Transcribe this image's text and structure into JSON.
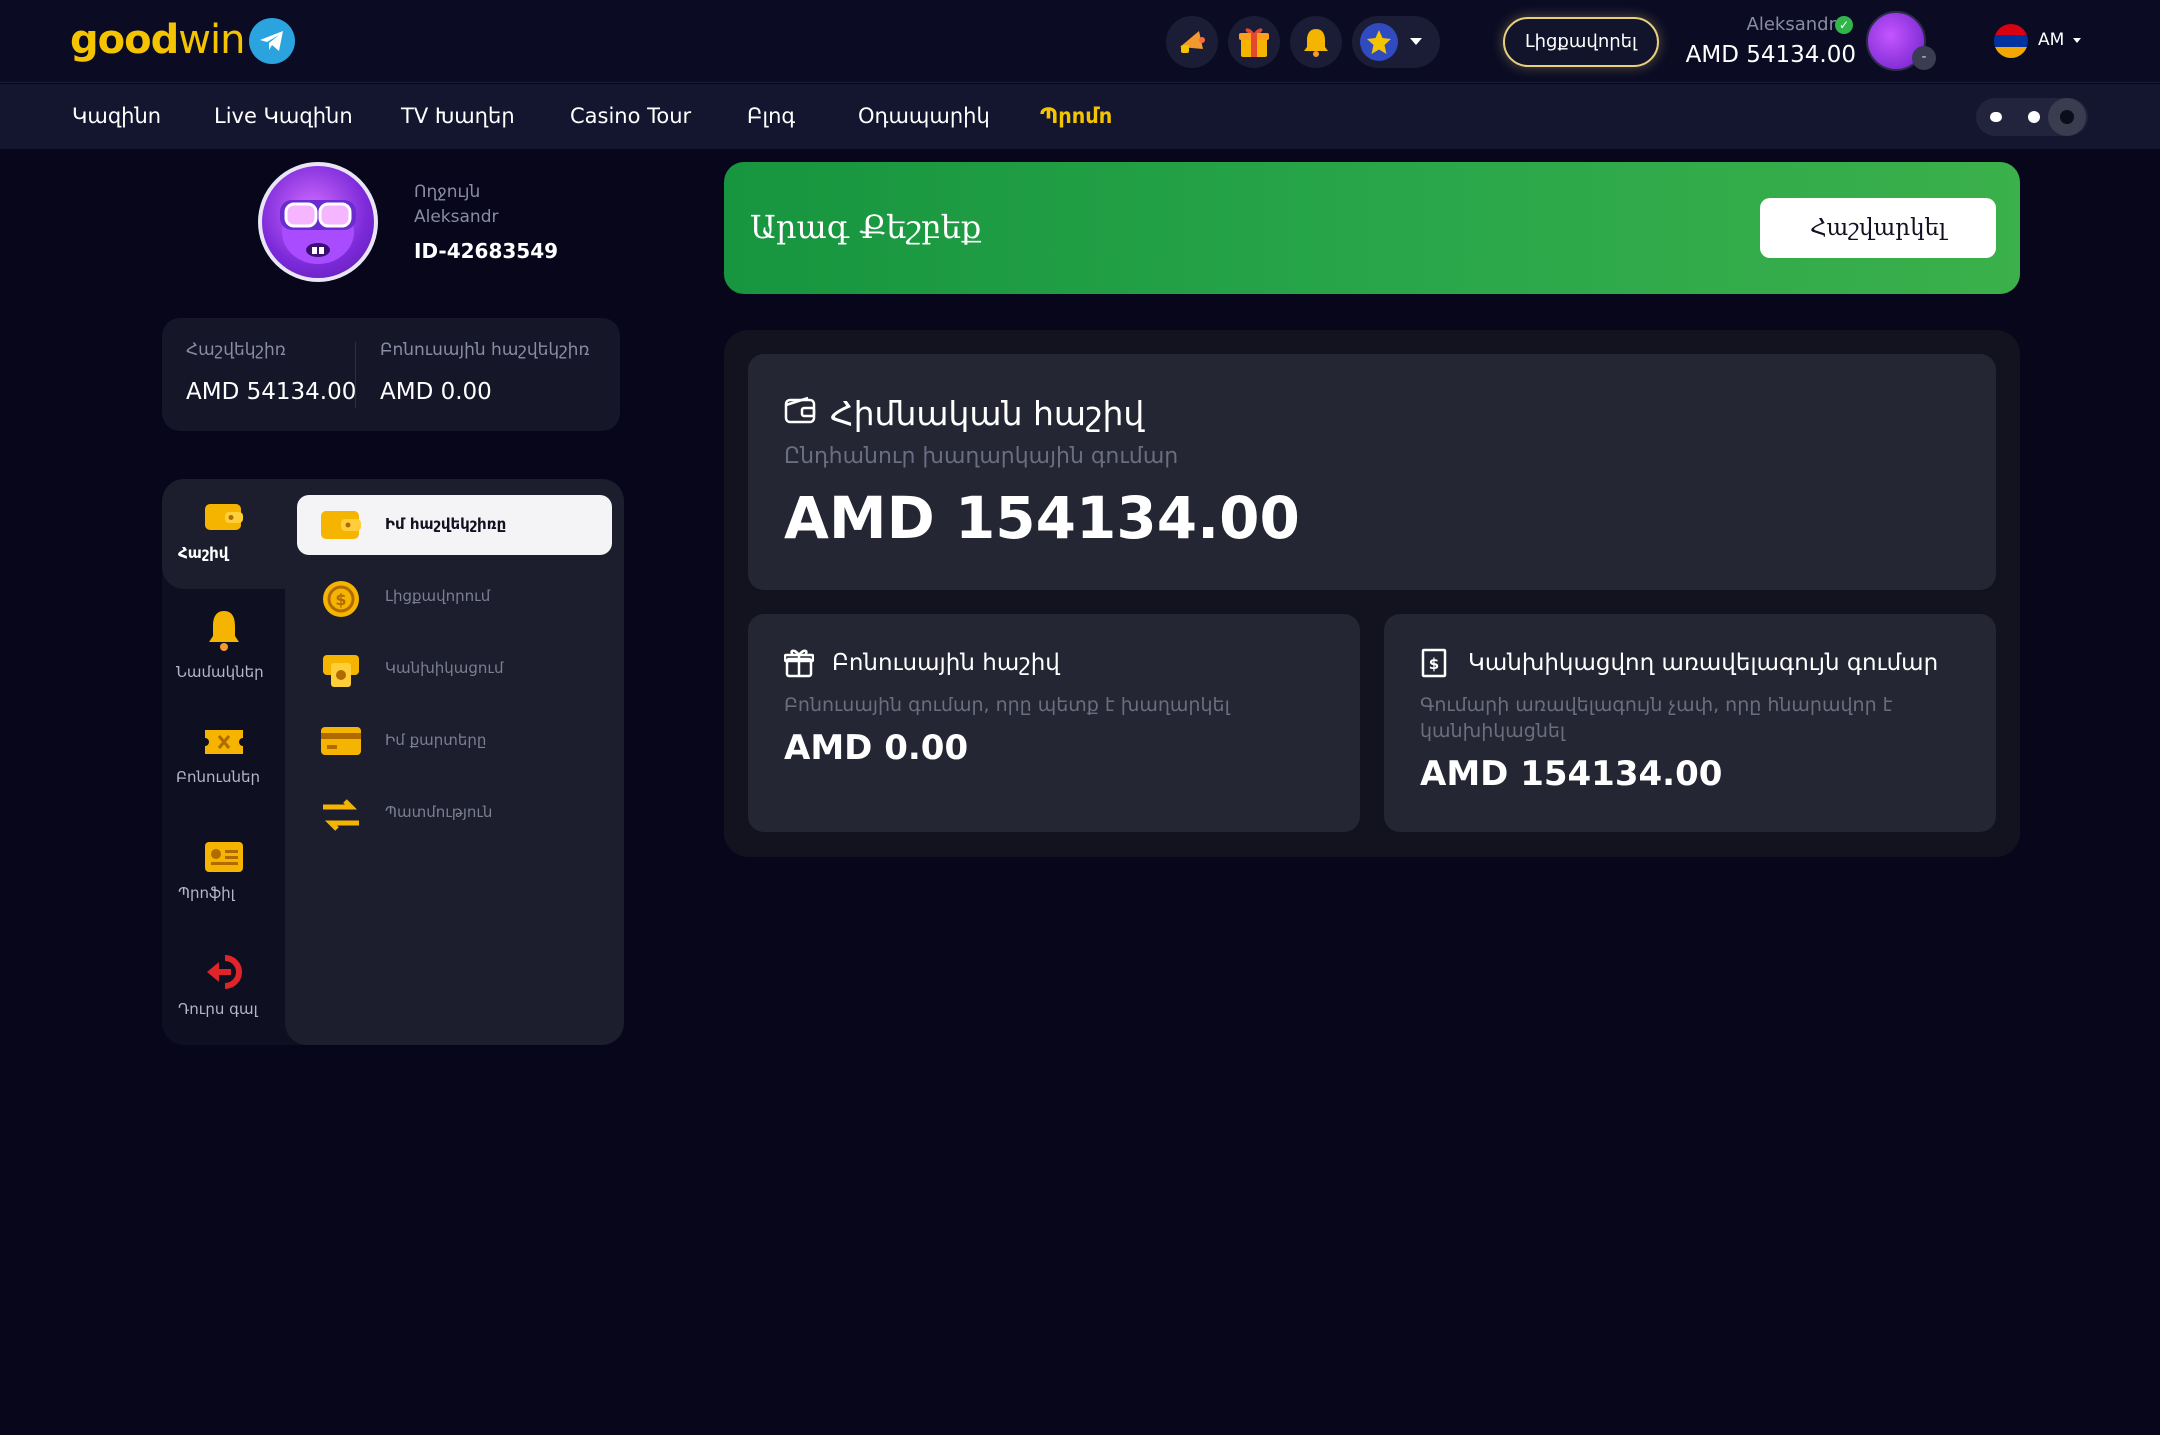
{
  "header": {
    "logo_good": "good",
    "logo_win": "win",
    "deposit_label": "Լիցքավորել",
    "user_name": "Aleksandr",
    "balance": "AMD  54134.00",
    "avatar_badge": "-",
    "language": "AM",
    "icons": [
      "telegram-icon",
      "megaphone-icon",
      "gift-icon",
      "bell-icon",
      "star-icon"
    ]
  },
  "nav": {
    "items": [
      "Կազինո",
      "Live Կազինո",
      "TV Խաղեր",
      "Casino Tour",
      "Բլոգ",
      "Օդապարիկ",
      "Պրոմո"
    ]
  },
  "profile": {
    "level": "Ողջույն",
    "name": "Aleksandr",
    "id": "ID-42683549"
  },
  "wallet": {
    "account_label": "Հաշվեկշիռ",
    "account_value": "AMD 54134.00",
    "bonus_label": "Բոնուսային հաշվեկշիռ",
    "bonus_value": "AMD 0.00"
  },
  "sidebar": {
    "items": [
      {
        "label": "Հաշիվ",
        "icon": "wallet-icon"
      },
      {
        "label": "Նամակներ",
        "icon": "bell-icon"
      },
      {
        "label": "Բոնուսներ",
        "icon": "ticket-icon"
      },
      {
        "label": "Պրոֆիլ",
        "icon": "id-card-icon"
      },
      {
        "label": "Դուրս գալ",
        "icon": "logout-icon"
      }
    ],
    "sub_items": [
      {
        "label": "Իմ հաշվեկշիռը",
        "icon": "wallet-icon"
      },
      {
        "label": "Լիցքավորում",
        "icon": "coin-icon"
      },
      {
        "label": "Կանխիկացում",
        "icon": "cash-icon"
      },
      {
        "label": "Իմ քարտերը",
        "icon": "card-icon"
      },
      {
        "label": "Պատմություն",
        "icon": "transfer-icon"
      }
    ]
  },
  "quick_bet": {
    "title": "Արագ Քեշբեք",
    "button": "Հաշվարկել"
  },
  "main_account": {
    "title": "Հիմնական հաշիվ",
    "subtitle": "Ընդհանուր խաղարկային գումար",
    "amount": "AMD 154134.00"
  },
  "bonus_account": {
    "title": "Բոնուսային հաշիվ",
    "subtitle": "Բոնուսային գումար, որը պետք է խաղարկել",
    "amount": "AMD 0.00"
  },
  "withdraw_account": {
    "title": "Կանխիկացվող առավելագույն գումար",
    "subtitle": "Գումարի առավելագույն չափ, որը հնարավոր է կանխիկացնել",
    "amount": "AMD 154134.00"
  },
  "colors": {
    "accent": "#f5c400",
    "green": "#2aa74a",
    "background": "#07061a"
  }
}
